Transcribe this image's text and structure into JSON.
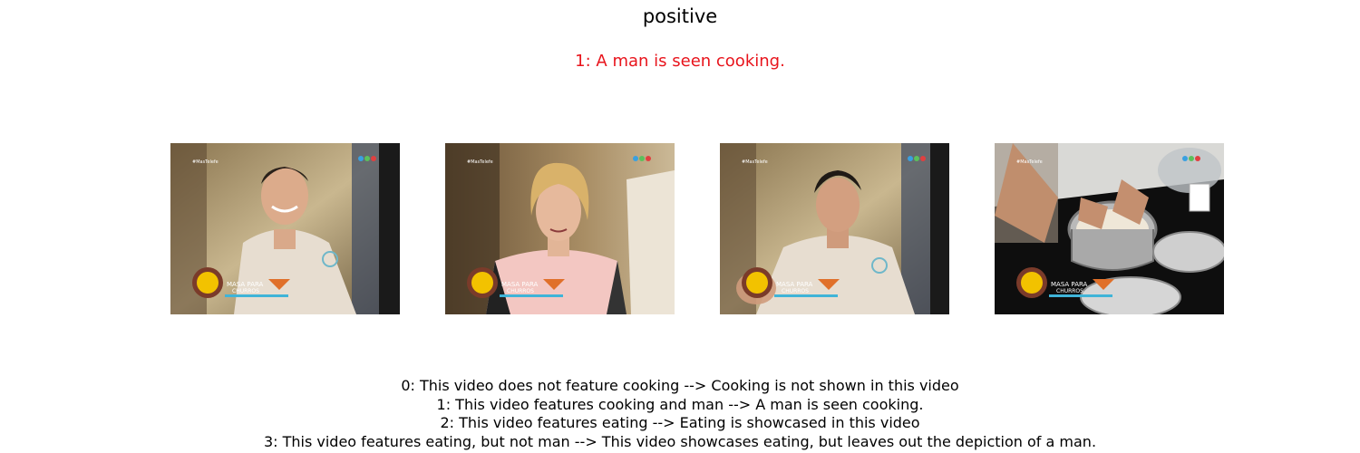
{
  "title": "positive",
  "prediction": {
    "text": "1: A man is seen cooking.",
    "color": "#e8141c"
  },
  "frames": [
    {
      "watermark": "#MasTelefe",
      "banner_line1": "MASA PARA",
      "banner_line2": "CHURROS",
      "logo": "COCINEROS ARGENTINOS"
    },
    {
      "watermark": "#MasTelefe",
      "banner_line1": "MASA PARA",
      "banner_line2": "CHURROS",
      "logo": "COCINEROS ARGENTINOS"
    },
    {
      "watermark": "#MasTelefe",
      "banner_line1": "MASA PARA",
      "banner_line2": "CHURROS",
      "logo": "COCINEROS ARGENTINOS"
    },
    {
      "watermark": "#MasTelefe",
      "banner_line1": "MASA PARA",
      "banner_line2": "CHURROS",
      "logo": "COCINEROS ARGENTINOS"
    }
  ],
  "captions": [
    "0: This video does not feature cooking --> Cooking is not shown in this video",
    "1: This video features cooking and man --> A man is seen cooking.",
    "2: This video features eating --> Eating is showcased in this video",
    "3: This video features eating, but not man --> This video showcases eating, but leaves out the depiction of a man."
  ]
}
